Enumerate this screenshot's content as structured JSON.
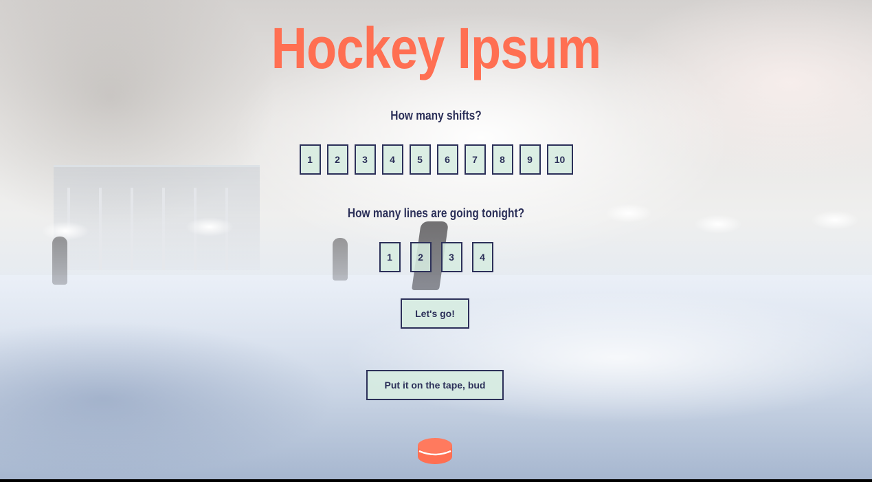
{
  "header": {
    "title": "Hockey Ipsum"
  },
  "shifts": {
    "question": "How many shifts?",
    "options": [
      "1",
      "2",
      "3",
      "4",
      "5",
      "6",
      "7",
      "8",
      "9",
      "10"
    ]
  },
  "lines": {
    "question": "How many lines are going tonight?",
    "options": [
      "1",
      "2",
      "3",
      "4"
    ]
  },
  "actions": {
    "go_label": "Let's go!",
    "tape_label": "Put it on the tape, bud"
  },
  "icons": {
    "puck": "hockey-puck-icon"
  },
  "colors": {
    "accent": "#ff6f52",
    "text": "#2c3059",
    "button_bg": "#d6ece0"
  }
}
